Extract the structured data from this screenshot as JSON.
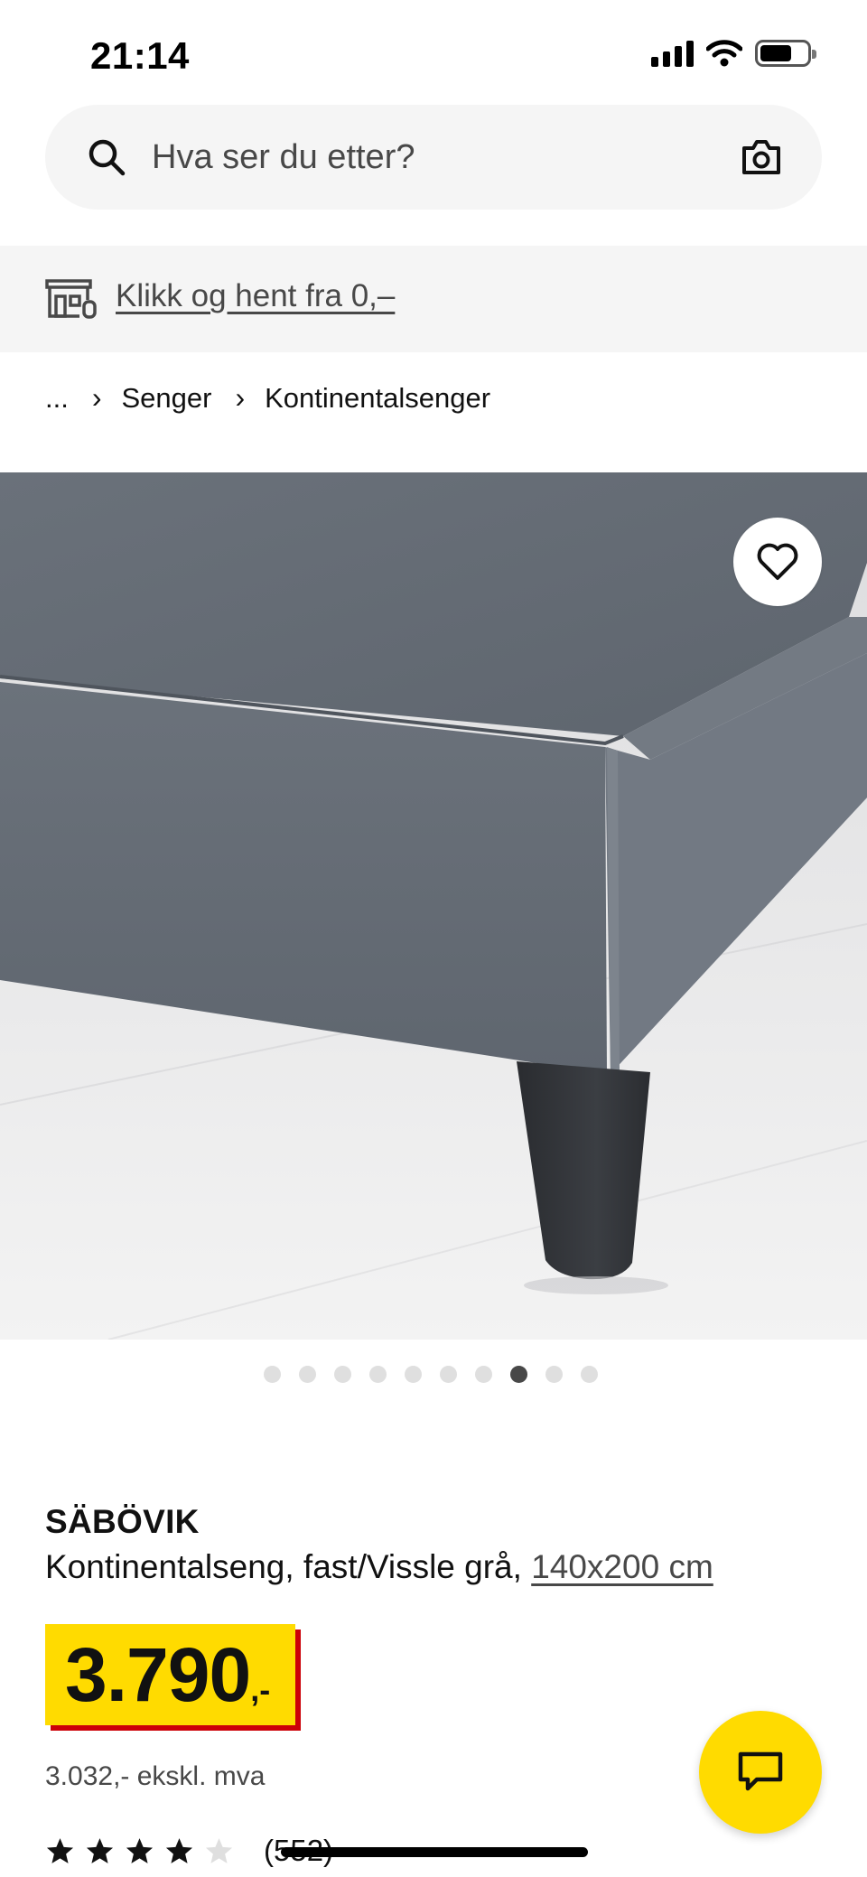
{
  "status_bar": {
    "time": "21:14",
    "icons": [
      "cellular-signal-icon",
      "wifi-icon",
      "battery-icon"
    ]
  },
  "search": {
    "placeholder": "Hva ser du etter?",
    "icons": [
      "search-icon",
      "camera-icon"
    ]
  },
  "collect_banner": {
    "icon": "store-pickup-icon",
    "link_text": "Klikk og hent fra 0,–"
  },
  "breadcrumb": {
    "items": [
      {
        "label": "..."
      },
      {
        "label": "Senger"
      },
      {
        "label": "Kontinentalsenger"
      }
    ],
    "separator": "›"
  },
  "gallery": {
    "image_count": 10,
    "active_index": 7,
    "favorite_icon": "heart-icon"
  },
  "product": {
    "name": "SÄBÖVIK",
    "description": "Kontinentalseng, fast/Vissle grå,",
    "size_link": "140x200 cm",
    "price_main": "3.790",
    "price_suffix": ",-",
    "price_ex_vat": "3.032,- ekskl. mva",
    "rating": {
      "value": 4,
      "max": 5
    },
    "review_count": "(552)"
  },
  "chat": {
    "icon": "chat-icon"
  },
  "colors": {
    "brand_yellow": "#ffdb00",
    "price_shadow_red": "#cc0008",
    "text_dark": "#111111",
    "text_gray": "#484848",
    "surface_gray": "#f5f5f5"
  }
}
